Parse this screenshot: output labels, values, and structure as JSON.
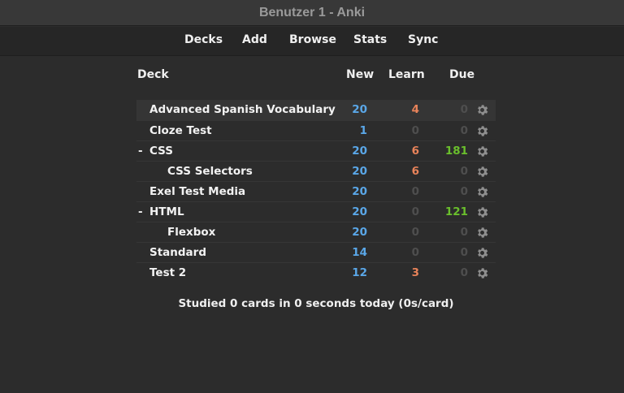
{
  "window": {
    "title": "Benutzer 1 - Anki"
  },
  "toolbar": {
    "decks": "Decks",
    "add": "Add",
    "browse": "Browse",
    "stats": "Stats",
    "sync": "Sync"
  },
  "table": {
    "headers": {
      "deck": "Deck",
      "new": "New",
      "learn": "Learn",
      "due": "Due"
    },
    "rows": [
      {
        "collapse": "",
        "name": "Advanced Spanish Vocabulary",
        "new": "20",
        "learn": "4",
        "due": "0"
      },
      {
        "collapse": "",
        "name": "Cloze Test",
        "new": "1",
        "learn": "0",
        "due": "0"
      },
      {
        "collapse": "-",
        "name": "CSS",
        "new": "20",
        "learn": "6",
        "due": "181"
      },
      {
        "collapse": "",
        "name": "CSS Selectors",
        "new": "20",
        "learn": "6",
        "due": "0"
      },
      {
        "collapse": "",
        "name": "Exel Test Media",
        "new": "20",
        "learn": "0",
        "due": "0"
      },
      {
        "collapse": "-",
        "name": "HTML",
        "new": "20",
        "learn": "0",
        "due": "121"
      },
      {
        "collapse": "",
        "name": "Flexbox",
        "new": "20",
        "learn": "0",
        "due": "0"
      },
      {
        "collapse": "",
        "name": "Standard",
        "new": "14",
        "learn": "0",
        "due": "0"
      },
      {
        "collapse": "",
        "name": "Test 2",
        "new": "12",
        "learn": "3",
        "due": "0"
      }
    ]
  },
  "footer": {
    "studied": "Studied 0 cards in 0 seconds today (0s/card)"
  },
  "icons": {
    "deck_options": "gear-icon"
  },
  "colors": {
    "new": "#5aa7e8",
    "learn": "#e8835a",
    "due": "#6abf2c",
    "zero": "#4e4e4e",
    "background": "#2c2c2c"
  }
}
